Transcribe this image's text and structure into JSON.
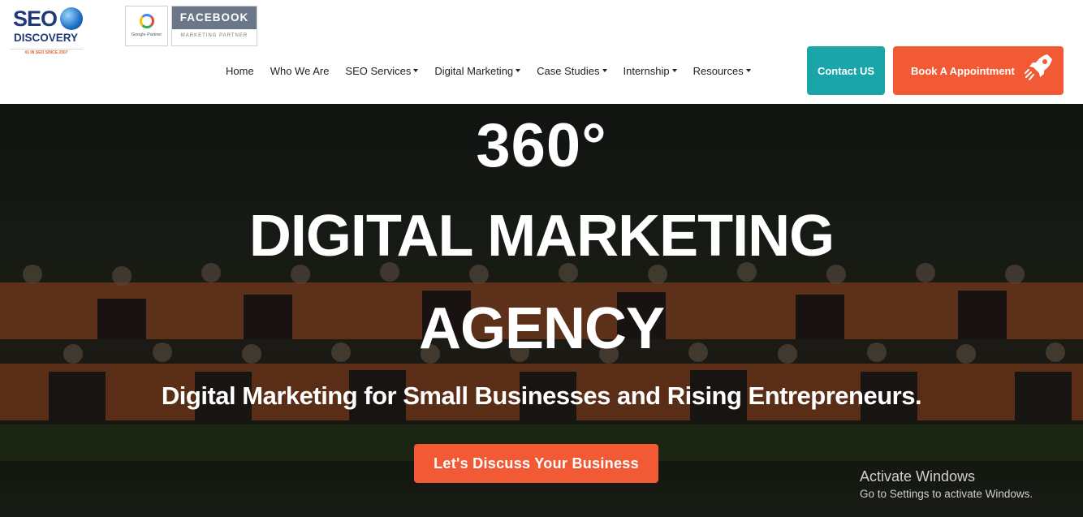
{
  "logo": {
    "line1": "SEO",
    "line2": "DISCOVERY",
    "tagline": "#1 IN SEO SINCE 2007"
  },
  "badges": {
    "google": "Google Partner",
    "facebook_top": "FACEBOOK",
    "facebook_bottom": "MARKETING PARTNER"
  },
  "nav": [
    {
      "label": "Home",
      "dropdown": false
    },
    {
      "label": "Who We Are",
      "dropdown": false
    },
    {
      "label": "SEO Services",
      "dropdown": true
    },
    {
      "label": "Digital Marketing",
      "dropdown": true
    },
    {
      "label": "Case Studies",
      "dropdown": true
    },
    {
      "label": "Internship",
      "dropdown": true
    },
    {
      "label": "Resources",
      "dropdown": true
    }
  ],
  "buttons": {
    "contact": "Contact US",
    "book": "Book A Appointment"
  },
  "hero": {
    "line1": "360°",
    "line2": "DIGITAL MARKETING",
    "line3": "AGENCY",
    "subtitle": "Digital Marketing for Small Businesses and Rising Entrepreneurs.",
    "cta": "Let's Discuss Your Business"
  },
  "watermark": {
    "title": "Activate Windows",
    "subtitle": "Go to Settings to activate Windows."
  },
  "colors": {
    "accent": "#f25a35",
    "teal": "#1aa5a8",
    "brand": "#1f3a77"
  }
}
